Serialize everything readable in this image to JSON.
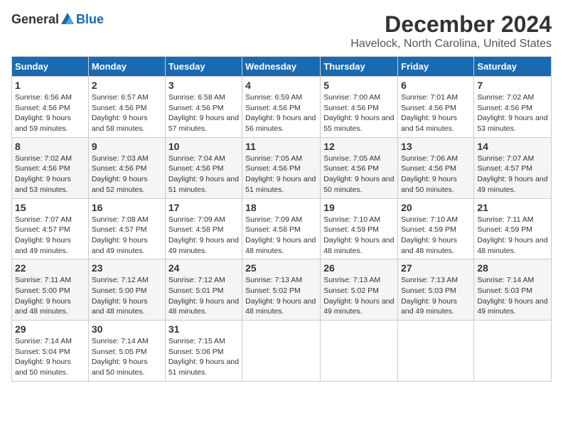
{
  "logo": {
    "general": "General",
    "blue": "Blue"
  },
  "title": "December 2024",
  "location": "Havelock, North Carolina, United States",
  "weekdays": [
    "Sunday",
    "Monday",
    "Tuesday",
    "Wednesday",
    "Thursday",
    "Friday",
    "Saturday"
  ],
  "weeks": [
    [
      {
        "day": 1,
        "sunrise": "6:56 AM",
        "sunset": "4:56 PM",
        "daylight": "9 hours and 59 minutes."
      },
      {
        "day": 2,
        "sunrise": "6:57 AM",
        "sunset": "4:56 PM",
        "daylight": "9 hours and 58 minutes."
      },
      {
        "day": 3,
        "sunrise": "6:58 AM",
        "sunset": "4:56 PM",
        "daylight": "9 hours and 57 minutes."
      },
      {
        "day": 4,
        "sunrise": "6:59 AM",
        "sunset": "4:56 PM",
        "daylight": "9 hours and 56 minutes."
      },
      {
        "day": 5,
        "sunrise": "7:00 AM",
        "sunset": "4:56 PM",
        "daylight": "9 hours and 55 minutes."
      },
      {
        "day": 6,
        "sunrise": "7:01 AM",
        "sunset": "4:56 PM",
        "daylight": "9 hours and 54 minutes."
      },
      {
        "day": 7,
        "sunrise": "7:02 AM",
        "sunset": "4:56 PM",
        "daylight": "9 hours and 53 minutes."
      }
    ],
    [
      {
        "day": 8,
        "sunrise": "7:02 AM",
        "sunset": "4:56 PM",
        "daylight": "9 hours and 53 minutes."
      },
      {
        "day": 9,
        "sunrise": "7:03 AM",
        "sunset": "4:56 PM",
        "daylight": "9 hours and 52 minutes."
      },
      {
        "day": 10,
        "sunrise": "7:04 AM",
        "sunset": "4:56 PM",
        "daylight": "9 hours and 51 minutes."
      },
      {
        "day": 11,
        "sunrise": "7:05 AM",
        "sunset": "4:56 PM",
        "daylight": "9 hours and 51 minutes."
      },
      {
        "day": 12,
        "sunrise": "7:05 AM",
        "sunset": "4:56 PM",
        "daylight": "9 hours and 50 minutes."
      },
      {
        "day": 13,
        "sunrise": "7:06 AM",
        "sunset": "4:56 PM",
        "daylight": "9 hours and 50 minutes."
      },
      {
        "day": 14,
        "sunrise": "7:07 AM",
        "sunset": "4:57 PM",
        "daylight": "9 hours and 49 minutes."
      }
    ],
    [
      {
        "day": 15,
        "sunrise": "7:07 AM",
        "sunset": "4:57 PM",
        "daylight": "9 hours and 49 minutes."
      },
      {
        "day": 16,
        "sunrise": "7:08 AM",
        "sunset": "4:57 PM",
        "daylight": "9 hours and 49 minutes."
      },
      {
        "day": 17,
        "sunrise": "7:09 AM",
        "sunset": "4:58 PM",
        "daylight": "9 hours and 49 minutes."
      },
      {
        "day": 18,
        "sunrise": "7:09 AM",
        "sunset": "4:58 PM",
        "daylight": "9 hours and 48 minutes."
      },
      {
        "day": 19,
        "sunrise": "7:10 AM",
        "sunset": "4:59 PM",
        "daylight": "9 hours and 48 minutes."
      },
      {
        "day": 20,
        "sunrise": "7:10 AM",
        "sunset": "4:59 PM",
        "daylight": "9 hours and 48 minutes."
      },
      {
        "day": 21,
        "sunrise": "7:11 AM",
        "sunset": "4:59 PM",
        "daylight": "9 hours and 48 minutes."
      }
    ],
    [
      {
        "day": 22,
        "sunrise": "7:11 AM",
        "sunset": "5:00 PM",
        "daylight": "9 hours and 48 minutes."
      },
      {
        "day": 23,
        "sunrise": "7:12 AM",
        "sunset": "5:00 PM",
        "daylight": "9 hours and 48 minutes."
      },
      {
        "day": 24,
        "sunrise": "7:12 AM",
        "sunset": "5:01 PM",
        "daylight": "9 hours and 48 minutes."
      },
      {
        "day": 25,
        "sunrise": "7:13 AM",
        "sunset": "5:02 PM",
        "daylight": "9 hours and 48 minutes."
      },
      {
        "day": 26,
        "sunrise": "7:13 AM",
        "sunset": "5:02 PM",
        "daylight": "9 hours and 49 minutes."
      },
      {
        "day": 27,
        "sunrise": "7:13 AM",
        "sunset": "5:03 PM",
        "daylight": "9 hours and 49 minutes."
      },
      {
        "day": 28,
        "sunrise": "7:14 AM",
        "sunset": "5:03 PM",
        "daylight": "9 hours and 49 minutes."
      }
    ],
    [
      {
        "day": 29,
        "sunrise": "7:14 AM",
        "sunset": "5:04 PM",
        "daylight": "9 hours and 50 minutes."
      },
      {
        "day": 30,
        "sunrise": "7:14 AM",
        "sunset": "5:05 PM",
        "daylight": "9 hours and 50 minutes."
      },
      {
        "day": 31,
        "sunrise": "7:15 AM",
        "sunset": "5:06 PM",
        "daylight": "9 hours and 51 minutes."
      },
      null,
      null,
      null,
      null
    ]
  ]
}
